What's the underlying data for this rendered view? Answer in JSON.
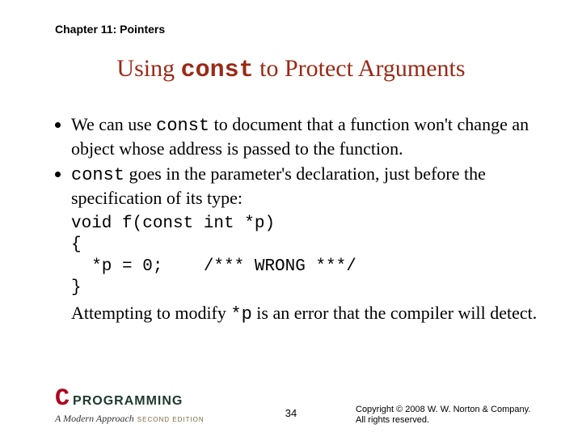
{
  "chapter": "Chapter 11: Pointers",
  "title_pre": "Using ",
  "title_mono": "const",
  "title_post": " to Protect Arguments",
  "bullet1_pre": "We can use ",
  "bullet1_mono": "const",
  "bullet1_post": " to document that a function won't change an object whose address is passed to the function.",
  "bullet2_mono": "const",
  "bullet2_post": " goes in the parameter's declaration, just before the specification of its type:",
  "code": "void f(const int *p)\n{\n  *p = 0;    /*** WRONG ***/\n}",
  "trailer_pre": "Attempting to modify ",
  "trailer_mono": "*p",
  "trailer_post": " is an error that the compiler will detect.",
  "page_number": "34",
  "copyright_l1": "Copyright © 2008 W. W. Norton & Company.",
  "copyright_l2": "All rights reserved.",
  "logo_c": "C",
  "logo_word": "PROGRAMMING",
  "logo_sub": "A Modern Approach",
  "logo_ed": "SECOND EDITION"
}
